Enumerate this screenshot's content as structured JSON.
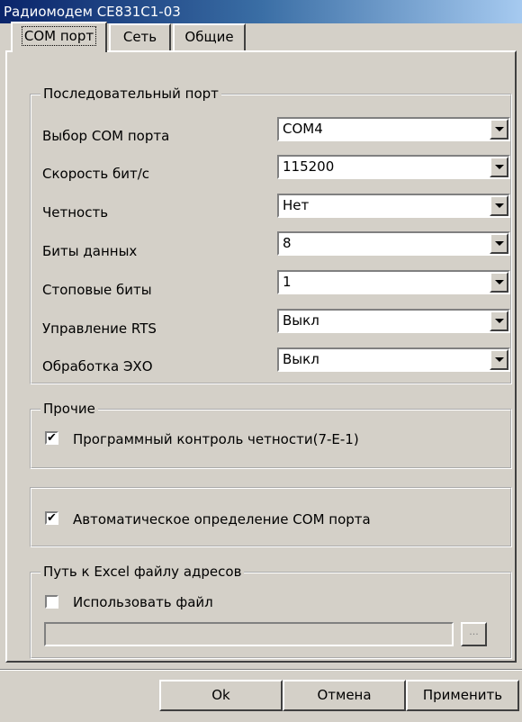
{
  "window": {
    "title": "Радиомодем CE831C1-03"
  },
  "tabs": [
    {
      "label": "COM порт",
      "active": true
    },
    {
      "label": "Сеть",
      "active": false
    },
    {
      "label": "Общие",
      "active": false
    }
  ],
  "serial_port": {
    "legend": "Последовательный порт",
    "fields": [
      {
        "label": "Выбор COM порта",
        "value": "COM4"
      },
      {
        "label": "Скорость бит/с",
        "value": "115200"
      },
      {
        "label": "Четность",
        "value": "Нет"
      },
      {
        "label": "Биты данных",
        "value": "8"
      },
      {
        "label": "Стоповые биты",
        "value": "1"
      },
      {
        "label": "Управление RTS",
        "value": "Выкл"
      },
      {
        "label": "Обработка ЭХО",
        "value": "Выкл"
      }
    ]
  },
  "other": {
    "legend": "Прочие",
    "parity_check": {
      "label": "Программный контроль четности(7-E-1)",
      "checked": true
    }
  },
  "auto_detect": {
    "label": "Автоматическое определение COM порта",
    "checked": true
  },
  "excel": {
    "legend": "Путь к Excel файлу адресов",
    "use_file": {
      "label": "Использовать файл",
      "checked": false
    },
    "path_value": "",
    "browse_label": "..."
  },
  "buttons": {
    "ok": "Ok",
    "cancel": "Отмена",
    "apply": "Применить"
  },
  "checkmark_glyph": "✔"
}
